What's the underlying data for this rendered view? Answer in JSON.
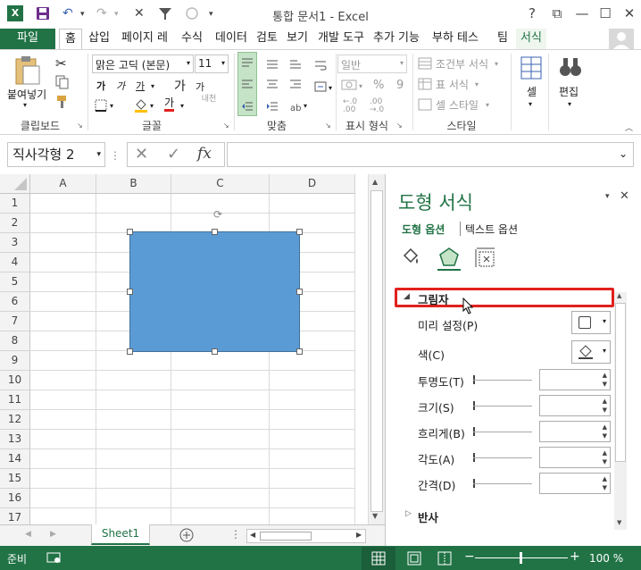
{
  "window": {
    "title": "통합 문서1 - Excel",
    "help": "?",
    "restore": "⧉",
    "minimize": "—",
    "maximize": "☐",
    "close": "✕"
  },
  "tabs": [
    "파일",
    "홈",
    "삽입",
    "페이지 레",
    "수식",
    "데이터",
    "검토",
    "보기",
    "개발 도구",
    "추가 기능",
    "부하 테스",
    "팀",
    "서식"
  ],
  "ribbon": {
    "clipboard": {
      "paste": "붙여넣기",
      "label": "클립보드"
    },
    "font": {
      "name": "맑은 고딕 (본문)",
      "size": "11",
      "label": "글꼴",
      "bold": "가",
      "italic": "가",
      "underline": "가",
      "grow": "가",
      "shrink": "가",
      "color_letter": "가",
      "phonetic": "내천"
    },
    "align": {
      "label": "맞춤"
    },
    "number": {
      "format": "일반",
      "pct": "%",
      "comma": "9",
      "label": "표시 형식"
    },
    "styles": {
      "cond": "조건부 서식",
      "table": "표 서식",
      "cell": "셀 스타일",
      "label": "스타일"
    },
    "cells": {
      "label": "셀"
    },
    "edit": {
      "label": "편집"
    }
  },
  "formula_bar": {
    "name_box": "직사각형 2",
    "cancel": "✕",
    "enter": "✓",
    "fx": "fx",
    "value": ""
  },
  "sheet": {
    "columns": [
      "A",
      "B",
      "C",
      "D"
    ],
    "rows": [
      "1",
      "2",
      "3",
      "4",
      "5",
      "6",
      "7",
      "8",
      "9",
      "10",
      "11",
      "12",
      "13",
      "14",
      "15",
      "16",
      "17"
    ],
    "shape_fill": "#5b9bd5",
    "tab": "Sheet1"
  },
  "pane": {
    "title": "도형 서식",
    "tab_shape": "도형 옵션",
    "tab_text": "텍스트 옵션",
    "section_shadow": "그림자",
    "presets": "미리 설정(P)",
    "color": "색(C)",
    "transparency": "투명도(T)",
    "size": "크기(S)",
    "blur": "흐리게(B)",
    "angle": "각도(A)",
    "distance": "간격(D)",
    "section_reflection": "반사",
    "accent": "#217346",
    "highlight": "#e0211e"
  },
  "status": {
    "ready": "준비",
    "zoom": "100 %",
    "minus": "−",
    "plus": "+"
  }
}
